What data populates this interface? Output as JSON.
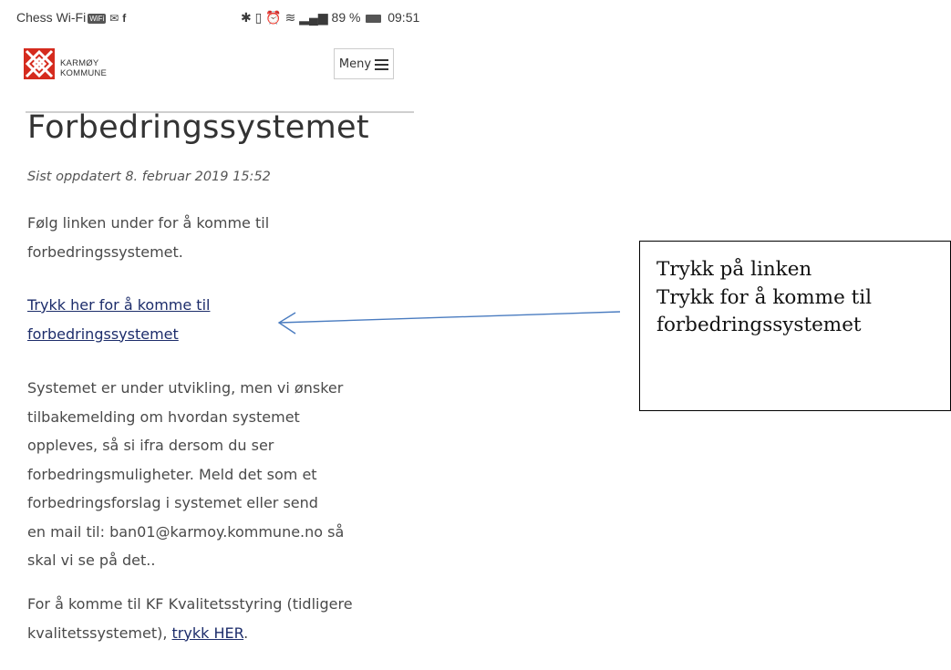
{
  "status_bar": {
    "carrier": "Chess Wi-Fi",
    "carrier_badge": "WiFi",
    "icons_left": [
      "wifi-call-icon",
      "voicemail-icon",
      "facebook-icon"
    ],
    "icons_right": [
      "bluetooth-icon",
      "vibrate-icon",
      "alarm-icon",
      "wifi-icon",
      "signal-icon",
      "battery-icon"
    ],
    "battery": "89 %",
    "time": "09:51"
  },
  "header": {
    "logo_line1": "KARMØY",
    "logo_line2": "KOMMUNE",
    "menu_label": "Meny",
    "logo_color": "#d52b1e"
  },
  "page": {
    "title": "Forbedringssystemet",
    "updated": "Sist oppdatert 8. februar 2019 15:52",
    "intro": "Følg linken under for å komme til\nforbedringssystemet.",
    "link_text": "Trykk her for å komme til\nforbedringssystemet",
    "body": "Systemet er under utvikling, men vi ønsker\ntilbakemelding om hvordan systemet\noppleves, så si ifra dersom du ser\nforbedringsmuligheter. Meld det som et\nforbedringsforslag i systemet eller send\nen mail til: ban01@karmoy.kommune.no så\nskal vi se på det..",
    "footer_prefix": "For å komme til KF Kvalitetsstyring (tidligere\nkvalitetssystemet), ",
    "footer_link": "trykk HER",
    "footer_suffix": ".",
    "link_color": "#1d2d6b"
  },
  "annotation": {
    "text": "Trykk på linken\nTrykk for å komme til\nforbedringssystemet",
    "arrow_color": "#4a7cc0"
  }
}
